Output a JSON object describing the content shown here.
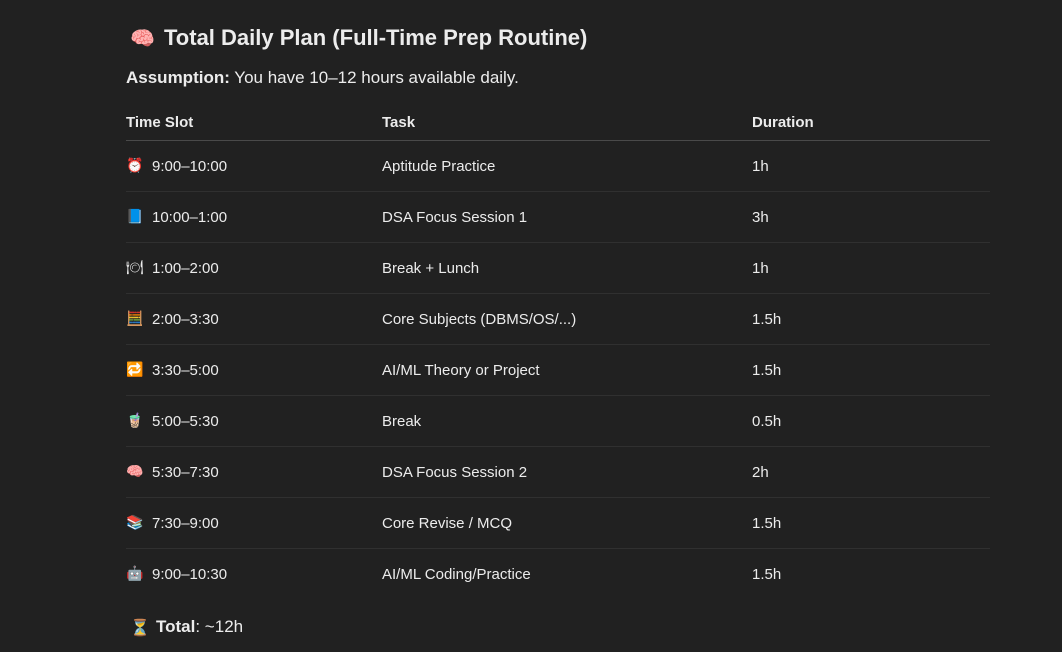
{
  "title": {
    "icon": "🧠",
    "text": "Total Daily Plan (Full-Time Prep Routine)"
  },
  "assumption": {
    "label": "Assumption:",
    "text": " You have 10–12 hours available daily."
  },
  "table": {
    "headers": [
      "Time Slot",
      "Task",
      "Duration"
    ],
    "rows": [
      {
        "icon": "⏰",
        "slot": "9:00–10:00",
        "task": "Aptitude Practice",
        "duration": "1h"
      },
      {
        "icon": "📘",
        "slot": "10:00–1:00",
        "task": "DSA Focus Session 1",
        "duration": "3h"
      },
      {
        "icon": "🍽",
        "slot": "1:00–2:00",
        "task": "Break + Lunch",
        "duration": "1h"
      },
      {
        "icon": "🧮",
        "slot": "2:00–3:30",
        "task": "Core Subjects (DBMS/OS/...)",
        "duration": "1.5h"
      },
      {
        "icon": "🔁",
        "slot": "3:30–5:00",
        "task": "AI/ML Theory or Project",
        "duration": "1.5h"
      },
      {
        "icon": "🧋",
        "slot": "5:00–5:30",
        "task": "Break",
        "duration": "0.5h"
      },
      {
        "icon": "🧠",
        "slot": "5:30–7:30",
        "task": "DSA Focus Session 2",
        "duration": "2h"
      },
      {
        "icon": "📚",
        "slot": "7:30–9:00",
        "task": "Core Revise / MCQ",
        "duration": "1.5h"
      },
      {
        "icon": "🤖",
        "slot": "9:00–10:30",
        "task": "AI/ML Coding/Practice",
        "duration": "1.5h"
      }
    ]
  },
  "total": {
    "icon": "⏳",
    "label": "Total",
    "value": ": ~12h"
  }
}
